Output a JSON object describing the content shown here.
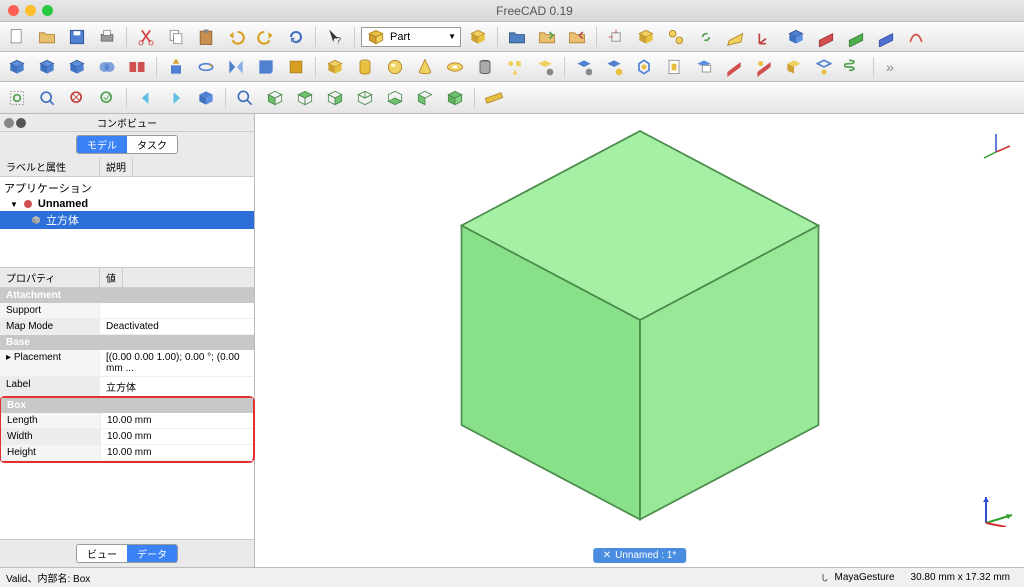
{
  "window": {
    "title": "FreeCAD 0.19"
  },
  "combo": {
    "value": "Part"
  },
  "panel": {
    "title": "コンボビュー",
    "tabs": {
      "model": "モデル",
      "task": "タスク"
    },
    "tree_headers": {
      "label": "ラベルと属性",
      "desc": "説明"
    },
    "tree": {
      "root": "アプリケーション",
      "doc": "Unnamed",
      "item": "立方体"
    },
    "prop_headers": {
      "prop": "プロパティ",
      "val": "値"
    },
    "groups": {
      "attachment": "Attachment",
      "base": "Base",
      "box": "Box"
    },
    "props": {
      "support": {
        "k": "Support",
        "v": ""
      },
      "map_mode": {
        "k": "Map Mode",
        "v": "Deactivated"
      },
      "placement": {
        "k": "Placement",
        "v": "[(0.00 0.00 1.00); 0.00 °; (0.00 mm ..."
      },
      "label": {
        "k": "Label",
        "v": "立方体"
      },
      "length": {
        "k": "Length",
        "v": "10.00 mm"
      },
      "width": {
        "k": "Width",
        "v": "10.00 mm"
      },
      "height": {
        "k": "Height",
        "v": "10.00 mm"
      }
    },
    "bottom_tabs": {
      "view": "ビュー",
      "data": "データ"
    }
  },
  "doctab": {
    "label": "Unnamed : 1*"
  },
  "status": {
    "msg": "Valid、内部名: Box",
    "nav": "MayaGesture",
    "dim": "30.80 mm x 17.32 mm"
  },
  "icons": {
    "new": "new-doc",
    "open": "open",
    "save": "save",
    "print": "print",
    "cut": "cut",
    "copy": "copy",
    "paste": "paste",
    "undo": "undo",
    "redo": "redo",
    "refresh": "refresh",
    "cursor": "cursor",
    "link": "link",
    "folder": "folder",
    "import": "import",
    "export": "export",
    "proj": "project",
    "origin": "origin",
    "wire": "wire",
    "datum": "datum",
    "part": "part",
    "variant": "variant"
  }
}
